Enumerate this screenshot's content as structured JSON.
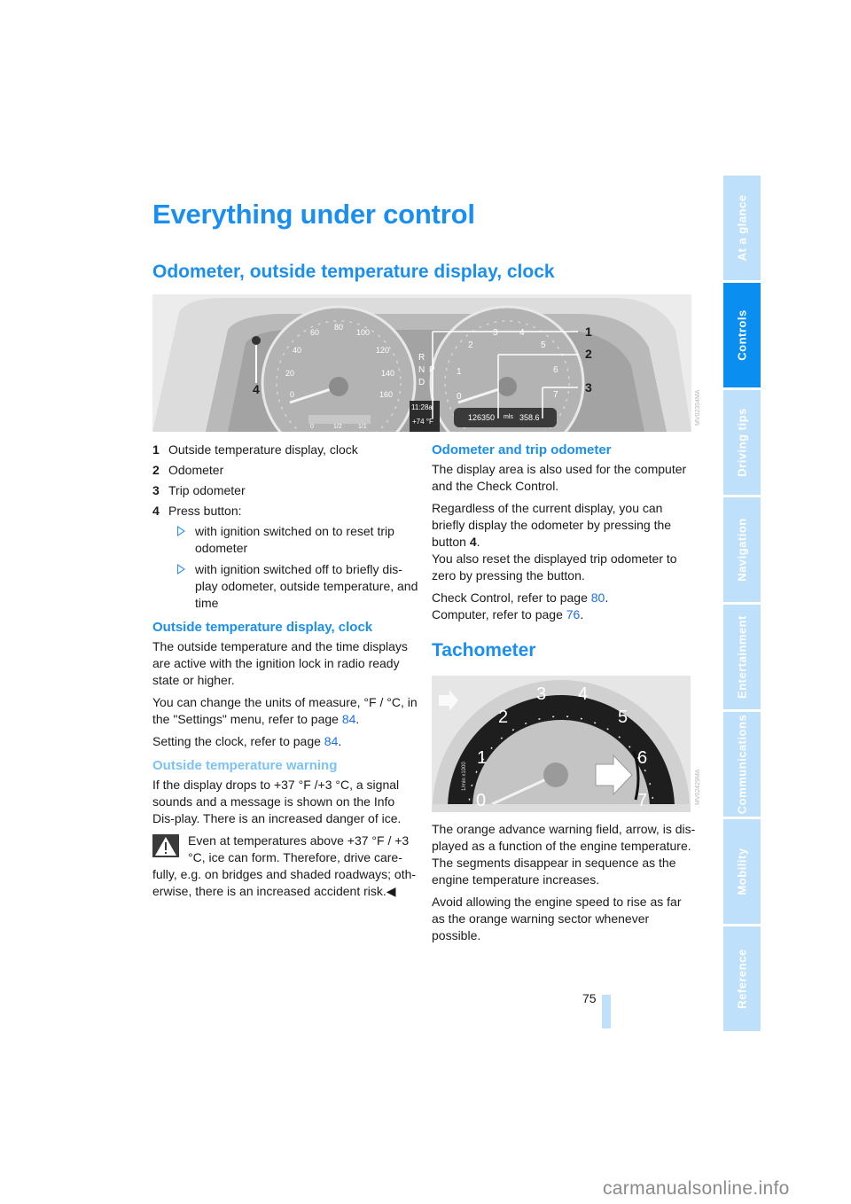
{
  "page": {
    "title": "Everything under control",
    "page_number": "75",
    "watermark": "carmanualsonline.info"
  },
  "side_tabs": [
    {
      "label": "At a glance",
      "active": false
    },
    {
      "label": "Controls",
      "active": true
    },
    {
      "label": "Driving tips",
      "active": false
    },
    {
      "label": "Navigation",
      "active": false
    },
    {
      "label": "Entertainment",
      "active": false
    },
    {
      "label": "Communications",
      "active": false
    },
    {
      "label": "Mobility",
      "active": false
    },
    {
      "label": "Reference",
      "active": false
    }
  ],
  "section1": {
    "heading": "Odometer, outside temperature display, clock",
    "figure": {
      "callouts": [
        "1",
        "2",
        "3",
        "4"
      ],
      "speedo_ticks": [
        "0",
        "20",
        "40",
        "60",
        "80",
        "100",
        "120",
        "140",
        "160"
      ],
      "tacho_ticks": [
        "0",
        "1",
        "2",
        "3",
        "4",
        "5",
        "6",
        "7"
      ],
      "gear_letters": [
        "R",
        "N",
        "D",
        "P"
      ],
      "fuel_labels": [
        "0",
        "1/2",
        "1/1"
      ],
      "clock": "11:28a",
      "temperature": "+74 °F",
      "odometer": "126350",
      "unit": "mls",
      "trip": "358.6",
      "side_code": "MV02354MA"
    },
    "legend": [
      {
        "num": "1",
        "text": "Outside temperature display, clock"
      },
      {
        "num": "2",
        "text": "Odometer"
      },
      {
        "num": "3",
        "text": "Trip odometer"
      },
      {
        "num": "4",
        "text": "Press button:"
      }
    ],
    "bullets": [
      "with ignition switched on to reset trip odometer",
      "with ignition switched off to briefly dis-play odometer, outside temperature, and time"
    ]
  },
  "sub_clock": {
    "heading": "Outside temperature display, clock",
    "p1": "The outside temperature and the time displays are active with the ignition lock in radio ready state or higher.",
    "p2_pre": "You can change the units of measure, °F / °C, in the \"Settings\" menu, refer to page ",
    "p2_link": "84",
    "p3_pre": "Setting the clock, refer to page ",
    "p3_link": "84"
  },
  "sub_warning": {
    "heading": "Outside temperature warning",
    "p1": "If the display drops to +37 °F /+3 °C, a signal sounds and a message is shown on the Info Dis-play. There is an increased danger of ice.",
    "caution": "Even at temperatures above +37 °F / +3 °C, ice can form. Therefore, drive care-fully, e.g. on bridges and shaded roadways; oth-erwise, there is an increased accident risk."
  },
  "sub_odometer": {
    "heading": "Odometer and trip odometer",
    "p1": "The display area is also used for the computer and the Check Control.",
    "p2_pre": "Regardless of the current display, you can briefly display the odometer by pressing the button ",
    "p2_bold": "4",
    "p2_post": "You also reset the displayed trip odometer to zero by pressing the button.",
    "p3_pre": "Check Control, refer to page ",
    "p3_link": "80",
    "p4_pre": "Computer, refer to page ",
    "p4_link": "76"
  },
  "section2": {
    "heading": "Tachometer",
    "figure": {
      "ticks": [
        "0",
        "1",
        "2",
        "3",
        "4",
        "5",
        "6",
        "7"
      ],
      "unit_label": "1/min x1000",
      "side_code": "MV02429MA"
    },
    "p1": "The orange advance warning field, arrow, is dis-played as a function of the engine temperature. The segments disappear in sequence as the engine temperature increases.",
    "p2": "Avoid allowing the engine speed to rise as far as the orange warning sector whenever possible."
  }
}
